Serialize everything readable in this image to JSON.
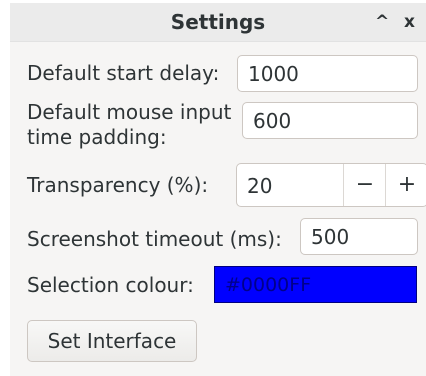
{
  "window": {
    "title": "Settings",
    "minimize_label": "^",
    "close_label": "x"
  },
  "fields": {
    "start_delay": {
      "label": "Default start delay:",
      "value": "1000"
    },
    "mouse_padding": {
      "label_line1": "Default mouse input",
      "label_line2": "time padding:",
      "value": "600"
    },
    "transparency": {
      "label": "Transparency (%):",
      "value": "20",
      "decrement": "−",
      "increment": "+"
    },
    "screenshot_timeout": {
      "label": "Screenshot timeout (ms):",
      "value": "500"
    },
    "selection_colour": {
      "label": "Selection colour:",
      "value": "#0000FF",
      "color": "#0000FF"
    }
  },
  "buttons": {
    "set_interface": "Set Interface"
  }
}
